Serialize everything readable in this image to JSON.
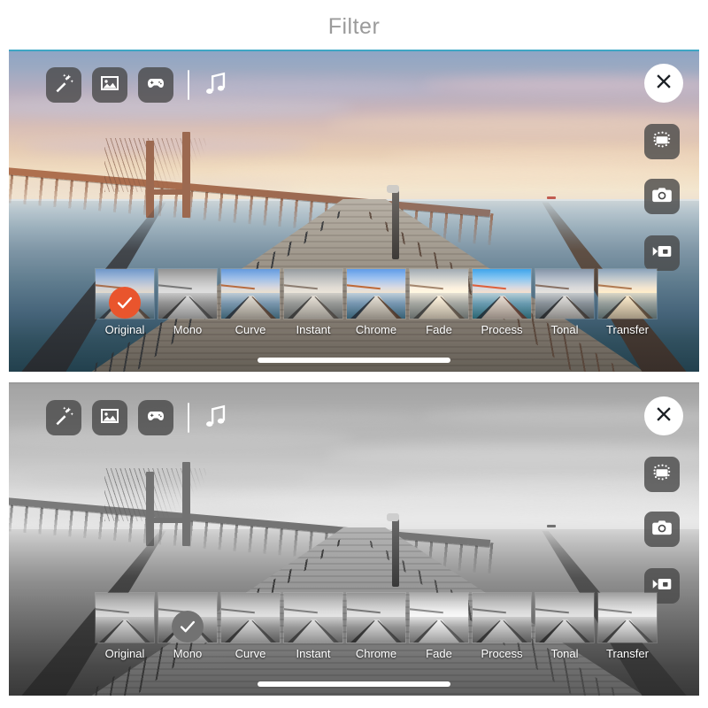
{
  "page": {
    "title": "Filter",
    "background_color": "#ffffff",
    "title_color": "#9b9b9b",
    "accent_color": "#e9552d",
    "panel_border_color": "#3ea6c4"
  },
  "panels": [
    {
      "id": "panel-color",
      "mode": "color",
      "selected_filter": "Original",
      "toolbar": {
        "items": [
          {
            "icon": "magic-wand-icon",
            "label": "Effects"
          },
          {
            "icon": "photo-icon",
            "label": "Photo"
          },
          {
            "icon": "game-controller-icon",
            "label": "Games"
          }
        ],
        "divider": true,
        "music": {
          "icon": "music-note-icon",
          "label": "Music"
        }
      },
      "rail": {
        "close": {
          "icon": "close-icon",
          "label": "Close"
        },
        "items": [
          {
            "icon": "crop-rotate-icon",
            "label": "Crop"
          },
          {
            "icon": "camera-icon",
            "label": "Camera"
          },
          {
            "icon": "video-camera-icon",
            "label": "Video"
          }
        ]
      },
      "home_indicator": true
    },
    {
      "id": "panel-mono",
      "mode": "grayscale",
      "selected_filter": "Mono",
      "toolbar": {
        "items": [
          {
            "icon": "magic-wand-icon",
            "label": "Effects"
          },
          {
            "icon": "photo-icon",
            "label": "Photo"
          },
          {
            "icon": "game-controller-icon",
            "label": "Games"
          }
        ],
        "divider": true,
        "music": {
          "icon": "music-note-icon",
          "label": "Music"
        }
      },
      "rail": {
        "close": {
          "icon": "close-icon",
          "label": "Close"
        },
        "items": [
          {
            "icon": "crop-rotate-icon",
            "label": "Crop"
          },
          {
            "icon": "camera-icon",
            "label": "Camera"
          },
          {
            "icon": "video-camera-icon",
            "label": "Video"
          }
        ]
      },
      "home_indicator": true
    }
  ],
  "filters": [
    {
      "name": "Original",
      "class": ""
    },
    {
      "name": "Mono",
      "class": "f-mono"
    },
    {
      "name": "Curve",
      "class": "f-curve"
    },
    {
      "name": "Instant",
      "class": "f-instant"
    },
    {
      "name": "Chrome",
      "class": "f-chrome"
    },
    {
      "name": "Fade",
      "class": "f-fade"
    },
    {
      "name": "Process",
      "class": "f-process"
    },
    {
      "name": "Tonal",
      "class": "f-tonal"
    },
    {
      "name": "Transfer",
      "class": "f-transfer"
    }
  ]
}
